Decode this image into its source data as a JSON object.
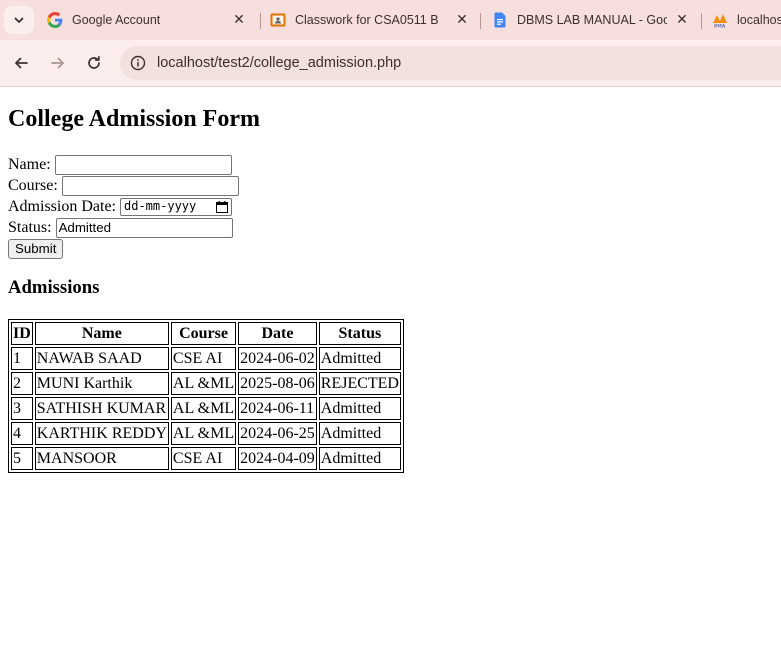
{
  "browser": {
    "tabs": [
      {
        "title": "Google Account",
        "icon": "google-g-icon"
      },
      {
        "title": "Classwork for CSA0511 B",
        "icon": "google-classroom-icon"
      },
      {
        "title": "DBMS LAB MANUAL - Goog",
        "icon": "google-docs-icon"
      },
      {
        "title": "localhost",
        "icon": "phpmyadmin-icon"
      }
    ],
    "close_glyph": "✕",
    "address": "localhost/test2/college_admission.php"
  },
  "page": {
    "title": "College Admission Form",
    "form": {
      "name_label": "Name: ",
      "name_value": "",
      "course_label": "Course: ",
      "course_value": "",
      "date_label": "Admission Date: ",
      "date_placeholder": "dd-mm-yyyy",
      "status_label": "Status: ",
      "status_value": "Admitted",
      "submit_label": "Submit"
    },
    "admissions_heading": "Admissions",
    "table": {
      "headers": [
        "ID",
        "Name",
        "Course",
        "Date",
        "Status"
      ],
      "rows": [
        [
          "1",
          "NAWAB SAAD",
          "CSE AI",
          "2024-06-02",
          "Admitted"
        ],
        [
          "2",
          "MUNI Karthik",
          "AL &ML",
          "2025-08-06",
          "REJECTED"
        ],
        [
          "3",
          "SATHISH KUMAR",
          "AL &ML",
          "2024-06-11",
          "Admitted"
        ],
        [
          "4",
          "KARTHIK REDDY",
          "AL &ML",
          "2024-06-25",
          "Admitted"
        ],
        [
          "5",
          "MANSOOR",
          "CSE AI",
          "2024-04-09",
          "Admitted"
        ]
      ]
    }
  },
  "colors": {
    "tabbar_bg": "#f6dfdc",
    "toolbar_bg": "#fbeeec",
    "omnibox_bg": "#f2e2df"
  }
}
